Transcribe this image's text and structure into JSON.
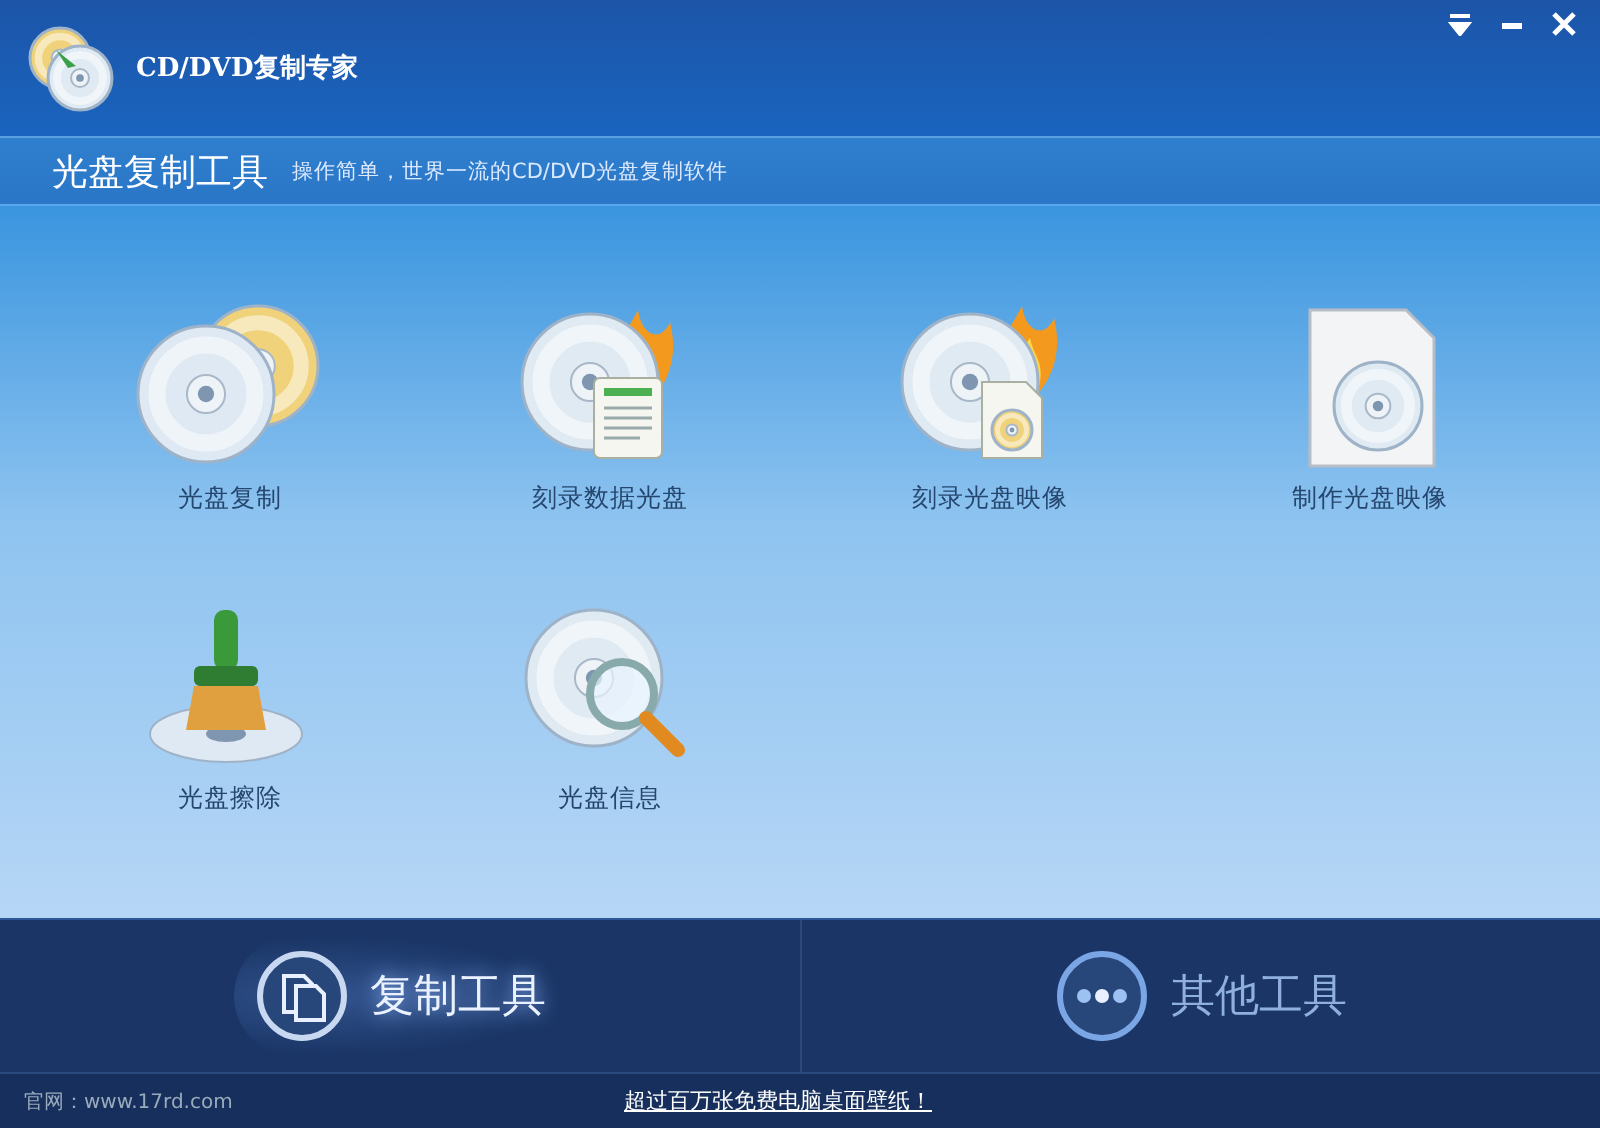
{
  "window": {
    "title": "CD/DVD复制专家"
  },
  "header": {
    "title": "光盘复制工具",
    "subtitle": "操作简单，世界一流的CD/DVD光盘复制软件"
  },
  "tools": [
    {
      "kind": "copy",
      "label": "光盘复制"
    },
    {
      "kind": "burn-data",
      "label": "刻录数据光盘"
    },
    {
      "kind": "burn-image",
      "label": "刻录光盘映像"
    },
    {
      "kind": "make-image",
      "label": "制作光盘映像"
    },
    {
      "kind": "erase",
      "label": "光盘擦除"
    },
    {
      "kind": "info",
      "label": "光盘信息"
    }
  ],
  "bottom_tabs": [
    {
      "kind": "copy",
      "label": "复制工具",
      "selected": true
    },
    {
      "kind": "more",
      "label": "其他工具",
      "selected": false
    }
  ],
  "footer": {
    "site": "官网：www.17rd.com",
    "link": "超过百万张免费电脑桌面壁纸！"
  }
}
